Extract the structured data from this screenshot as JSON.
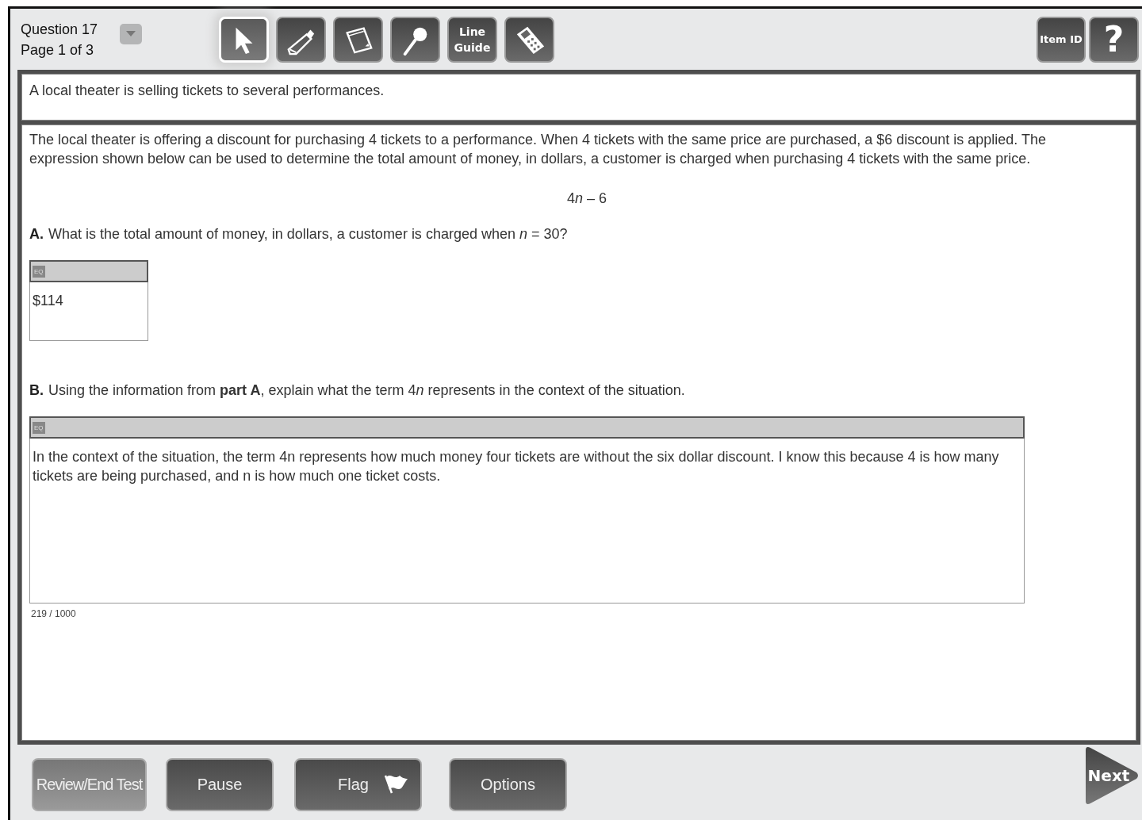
{
  "header": {
    "question": "Question 17",
    "page": "Page 1 of 3"
  },
  "tools": [
    {
      "kind": "pointer",
      "selected": true
    },
    {
      "kind": "highlighter",
      "selected": false
    },
    {
      "kind": "notepad",
      "selected": false
    },
    {
      "kind": "magnifier",
      "selected": false
    },
    {
      "kind": "line-guide",
      "label": "Line Guide",
      "selected": false
    },
    {
      "kind": "calculator",
      "selected": false
    }
  ],
  "help_buttons": [
    {
      "kind": "text",
      "label": "Item ID"
    },
    {
      "kind": "text",
      "label": "?"
    }
  ],
  "stem": "A local theater is selling tickets to several performances.",
  "question": {
    "intro": "The local theater is offering a discount for purchasing 4 tickets to a performance. When 4 tickets with the same price are purchased, a $6 discount is applied. The expression shown below can be used to determine the total amount of money, in dollars, a customer is charged when purchasing 4 tickets with the same price.",
    "expression": [
      "4",
      "*n* – 6"
    ],
    "parts": [
      {
        "letter": "A.",
        "prompt": [
          "What is the total amount of money, in dollars, a customer is charged when *n* = 30?"
        ],
        "kind": "short",
        "toolbar_label": "EQ",
        "answer": "$114"
      },
      {
        "letter": "B.",
        "prompt": [
          "Using the information from **part A**, explain what the term 4",
          "*n* represents in the context of the situation."
        ],
        "kind": "extended",
        "toolbar_label": "EQ",
        "answer": "In the context of the situation, the term 4n represents how much money four tickets are without the six dollar discount. I know this because 4 is how many tickets are being purchased, and n is how much one ticket costs.",
        "counter": "219 / 1000"
      }
    ]
  },
  "footer_buttons": [
    {
      "label": "Review/End Test",
      "kind": "plain"
    },
    {
      "label": "Pause",
      "kind": "plain"
    },
    {
      "label": "Flag",
      "kind": "flag"
    },
    {
      "label": "Options",
      "kind": "plain"
    }
  ],
  "next_button": {
    "label": "Next"
  }
}
